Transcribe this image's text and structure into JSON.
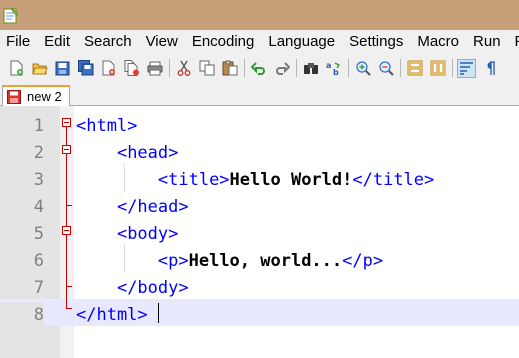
{
  "menu": [
    "File",
    "Edit",
    "Search",
    "View",
    "Encoding",
    "Language",
    "Settings",
    "Macro",
    "Run",
    "Plu"
  ],
  "toolbar_icons": [
    "new-file-icon",
    "open-file-icon",
    "save-icon",
    "save-all-icon",
    "close-icon",
    "close-all-icon",
    "print-icon",
    "cut-icon",
    "copy-icon",
    "paste-icon",
    "undo-icon",
    "redo-icon",
    "find-icon",
    "replace-icon",
    "zoom-in-icon",
    "zoom-out-icon",
    "sync-vertical-icon",
    "sync-horizontal-icon",
    "word-wrap-icon",
    "show-all-characters-icon"
  ],
  "tab": {
    "label": "new 2"
  },
  "editor": {
    "lines": [
      {
        "num": "1",
        "tokens": [
          {
            "t": "<html>",
            "k": "tag"
          }
        ]
      },
      {
        "num": "2",
        "tokens": [
          {
            "t": "    ",
            "k": "ws"
          },
          {
            "t": "<head>",
            "k": "tag"
          }
        ]
      },
      {
        "num": "3",
        "tokens": [
          {
            "t": "        ",
            "k": "ws"
          },
          {
            "t": "<title>",
            "k": "tag"
          },
          {
            "t": "Hello World!",
            "k": "txt"
          },
          {
            "t": "</title>",
            "k": "tag"
          }
        ]
      },
      {
        "num": "4",
        "tokens": [
          {
            "t": "    ",
            "k": "ws"
          },
          {
            "t": "</head>",
            "k": "tag"
          }
        ]
      },
      {
        "num": "5",
        "tokens": [
          {
            "t": "    ",
            "k": "ws"
          },
          {
            "t": "<body>",
            "k": "tag"
          }
        ]
      },
      {
        "num": "6",
        "tokens": [
          {
            "t": "        ",
            "k": "ws"
          },
          {
            "t": "<p>",
            "k": "tag"
          },
          {
            "t": "Hello, world...",
            "k": "txt"
          },
          {
            "t": "</p>",
            "k": "tag"
          }
        ]
      },
      {
        "num": "7",
        "tokens": [
          {
            "t": "    ",
            "k": "ws"
          },
          {
            "t": "</body>",
            "k": "tag"
          }
        ]
      },
      {
        "num": "8",
        "tokens": [
          {
            "t": "</html>",
            "k": "tag"
          }
        ]
      }
    ],
    "current_line": 8
  },
  "colors": {
    "tag": "#0000ff",
    "text": "#000000",
    "fold_marker": "#d00000",
    "current_line": "#e8e8ff",
    "titlebar": "#c7a07a"
  }
}
